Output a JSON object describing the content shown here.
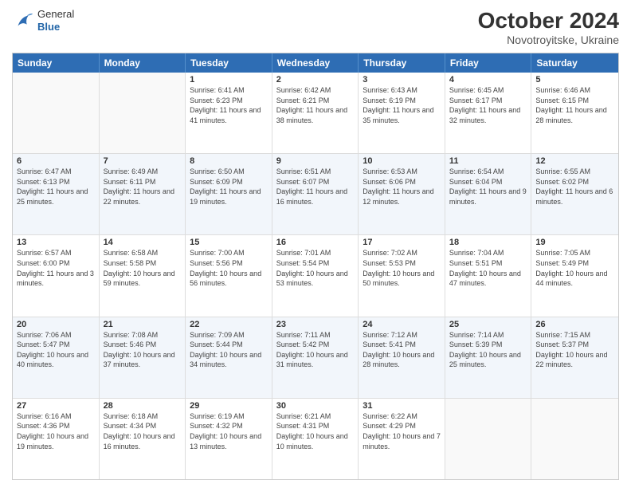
{
  "header": {
    "logo": {
      "general": "General",
      "blue": "Blue"
    },
    "title": "October 2024",
    "location": "Novotroyitske, Ukraine"
  },
  "days_of_week": [
    "Sunday",
    "Monday",
    "Tuesday",
    "Wednesday",
    "Thursday",
    "Friday",
    "Saturday"
  ],
  "weeks": [
    [
      {
        "day": "",
        "sunrise": "",
        "sunset": "",
        "daylight": "",
        "empty": true
      },
      {
        "day": "",
        "sunrise": "",
        "sunset": "",
        "daylight": "",
        "empty": true
      },
      {
        "day": "1",
        "sunrise": "Sunrise: 6:41 AM",
        "sunset": "Sunset: 6:23 PM",
        "daylight": "Daylight: 11 hours and 41 minutes.",
        "empty": false
      },
      {
        "day": "2",
        "sunrise": "Sunrise: 6:42 AM",
        "sunset": "Sunset: 6:21 PM",
        "daylight": "Daylight: 11 hours and 38 minutes.",
        "empty": false
      },
      {
        "day": "3",
        "sunrise": "Sunrise: 6:43 AM",
        "sunset": "Sunset: 6:19 PM",
        "daylight": "Daylight: 11 hours and 35 minutes.",
        "empty": false
      },
      {
        "day": "4",
        "sunrise": "Sunrise: 6:45 AM",
        "sunset": "Sunset: 6:17 PM",
        "daylight": "Daylight: 11 hours and 32 minutes.",
        "empty": false
      },
      {
        "day": "5",
        "sunrise": "Sunrise: 6:46 AM",
        "sunset": "Sunset: 6:15 PM",
        "daylight": "Daylight: 11 hours and 28 minutes.",
        "empty": false
      }
    ],
    [
      {
        "day": "6",
        "sunrise": "Sunrise: 6:47 AM",
        "sunset": "Sunset: 6:13 PM",
        "daylight": "Daylight: 11 hours and 25 minutes.",
        "empty": false
      },
      {
        "day": "7",
        "sunrise": "Sunrise: 6:49 AM",
        "sunset": "Sunset: 6:11 PM",
        "daylight": "Daylight: 11 hours and 22 minutes.",
        "empty": false
      },
      {
        "day": "8",
        "sunrise": "Sunrise: 6:50 AM",
        "sunset": "Sunset: 6:09 PM",
        "daylight": "Daylight: 11 hours and 19 minutes.",
        "empty": false
      },
      {
        "day": "9",
        "sunrise": "Sunrise: 6:51 AM",
        "sunset": "Sunset: 6:07 PM",
        "daylight": "Daylight: 11 hours and 16 minutes.",
        "empty": false
      },
      {
        "day": "10",
        "sunrise": "Sunrise: 6:53 AM",
        "sunset": "Sunset: 6:06 PM",
        "daylight": "Daylight: 11 hours and 12 minutes.",
        "empty": false
      },
      {
        "day": "11",
        "sunrise": "Sunrise: 6:54 AM",
        "sunset": "Sunset: 6:04 PM",
        "daylight": "Daylight: 11 hours and 9 minutes.",
        "empty": false
      },
      {
        "day": "12",
        "sunrise": "Sunrise: 6:55 AM",
        "sunset": "Sunset: 6:02 PM",
        "daylight": "Daylight: 11 hours and 6 minutes.",
        "empty": false
      }
    ],
    [
      {
        "day": "13",
        "sunrise": "Sunrise: 6:57 AM",
        "sunset": "Sunset: 6:00 PM",
        "daylight": "Daylight: 11 hours and 3 minutes.",
        "empty": false
      },
      {
        "day": "14",
        "sunrise": "Sunrise: 6:58 AM",
        "sunset": "Sunset: 5:58 PM",
        "daylight": "Daylight: 10 hours and 59 minutes.",
        "empty": false
      },
      {
        "day": "15",
        "sunrise": "Sunrise: 7:00 AM",
        "sunset": "Sunset: 5:56 PM",
        "daylight": "Daylight: 10 hours and 56 minutes.",
        "empty": false
      },
      {
        "day": "16",
        "sunrise": "Sunrise: 7:01 AM",
        "sunset": "Sunset: 5:54 PM",
        "daylight": "Daylight: 10 hours and 53 minutes.",
        "empty": false
      },
      {
        "day": "17",
        "sunrise": "Sunrise: 7:02 AM",
        "sunset": "Sunset: 5:53 PM",
        "daylight": "Daylight: 10 hours and 50 minutes.",
        "empty": false
      },
      {
        "day": "18",
        "sunrise": "Sunrise: 7:04 AM",
        "sunset": "Sunset: 5:51 PM",
        "daylight": "Daylight: 10 hours and 47 minutes.",
        "empty": false
      },
      {
        "day": "19",
        "sunrise": "Sunrise: 7:05 AM",
        "sunset": "Sunset: 5:49 PM",
        "daylight": "Daylight: 10 hours and 44 minutes.",
        "empty": false
      }
    ],
    [
      {
        "day": "20",
        "sunrise": "Sunrise: 7:06 AM",
        "sunset": "Sunset: 5:47 PM",
        "daylight": "Daylight: 10 hours and 40 minutes.",
        "empty": false
      },
      {
        "day": "21",
        "sunrise": "Sunrise: 7:08 AM",
        "sunset": "Sunset: 5:46 PM",
        "daylight": "Daylight: 10 hours and 37 minutes.",
        "empty": false
      },
      {
        "day": "22",
        "sunrise": "Sunrise: 7:09 AM",
        "sunset": "Sunset: 5:44 PM",
        "daylight": "Daylight: 10 hours and 34 minutes.",
        "empty": false
      },
      {
        "day": "23",
        "sunrise": "Sunrise: 7:11 AM",
        "sunset": "Sunset: 5:42 PM",
        "daylight": "Daylight: 10 hours and 31 minutes.",
        "empty": false
      },
      {
        "day": "24",
        "sunrise": "Sunrise: 7:12 AM",
        "sunset": "Sunset: 5:41 PM",
        "daylight": "Daylight: 10 hours and 28 minutes.",
        "empty": false
      },
      {
        "day": "25",
        "sunrise": "Sunrise: 7:14 AM",
        "sunset": "Sunset: 5:39 PM",
        "daylight": "Daylight: 10 hours and 25 minutes.",
        "empty": false
      },
      {
        "day": "26",
        "sunrise": "Sunrise: 7:15 AM",
        "sunset": "Sunset: 5:37 PM",
        "daylight": "Daylight: 10 hours and 22 minutes.",
        "empty": false
      }
    ],
    [
      {
        "day": "27",
        "sunrise": "Sunrise: 6:16 AM",
        "sunset": "Sunset: 4:36 PM",
        "daylight": "Daylight: 10 hours and 19 minutes.",
        "empty": false
      },
      {
        "day": "28",
        "sunrise": "Sunrise: 6:18 AM",
        "sunset": "Sunset: 4:34 PM",
        "daylight": "Daylight: 10 hours and 16 minutes.",
        "empty": false
      },
      {
        "day": "29",
        "sunrise": "Sunrise: 6:19 AM",
        "sunset": "Sunset: 4:32 PM",
        "daylight": "Daylight: 10 hours and 13 minutes.",
        "empty": false
      },
      {
        "day": "30",
        "sunrise": "Sunrise: 6:21 AM",
        "sunset": "Sunset: 4:31 PM",
        "daylight": "Daylight: 10 hours and 10 minutes.",
        "empty": false
      },
      {
        "day": "31",
        "sunrise": "Sunrise: 6:22 AM",
        "sunset": "Sunset: 4:29 PM",
        "daylight": "Daylight: 10 hours and 7 minutes.",
        "empty": false
      },
      {
        "day": "",
        "sunrise": "",
        "sunset": "",
        "daylight": "",
        "empty": true
      },
      {
        "day": "",
        "sunrise": "",
        "sunset": "",
        "daylight": "",
        "empty": true
      }
    ]
  ]
}
